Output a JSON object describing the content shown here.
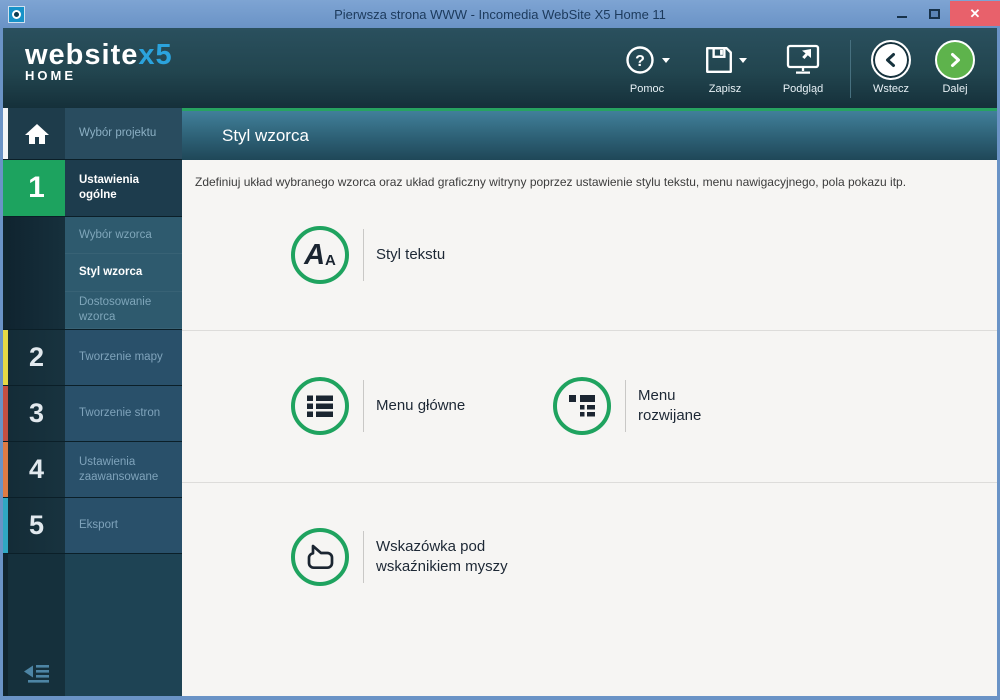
{
  "window": {
    "title": "Pierwsza strona WWW - Incomedia WebSite X5 Home 11",
    "controls": {
      "close": "✕"
    }
  },
  "toolbar": {
    "logo": {
      "brand": "website",
      "brand_accent": "x5",
      "edition": "HOME"
    },
    "help_glyph": "?",
    "buttons": [
      {
        "id": "pomoc",
        "label": "Pomoc",
        "icon": "help-icon",
        "has_dropdown": true
      },
      {
        "id": "zapisz",
        "label": "Zapisz",
        "icon": "save-icon",
        "has_dropdown": true
      },
      {
        "id": "podglad",
        "label": "Podgląd",
        "icon": "preview-icon",
        "has_dropdown": false
      }
    ],
    "nav": [
      {
        "id": "wstecz",
        "label": "Wstecz",
        "icon": "back-icon"
      },
      {
        "id": "dalej",
        "label": "Dalej",
        "icon": "next-icon"
      }
    ]
  },
  "sidebar": {
    "home_label": "Wybór projektu",
    "steps": [
      {
        "num": "1",
        "label": "Ustawienia ogólne",
        "active": true,
        "strip_color": "#1da35f"
      },
      {
        "num": "2",
        "label": "Tworzenie mapy",
        "active": false,
        "strip_color": "#e5d945"
      },
      {
        "num": "3",
        "label": "Tworzenie stron",
        "active": false,
        "strip_color": "#c44f42"
      },
      {
        "num": "4",
        "label": "Ustawienia zaawansowane",
        "active": false,
        "strip_color": "#de7b45"
      },
      {
        "num": "5",
        "label": "Eksport",
        "active": false,
        "strip_color": "#2fa7c3"
      }
    ],
    "sub_items": [
      {
        "label": "Wybór wzorca",
        "selected": false
      },
      {
        "label": "Styl wzorca",
        "selected": true
      },
      {
        "label": "Dostosowanie wzorca",
        "selected": false
      }
    ]
  },
  "main": {
    "title": "Styl wzorca",
    "description": "Zdefiniuj układ wybranego wzorca oraz układ graficzny witryny poprzez ustawienie stylu tekstu, menu nawigacyjnego, pola pokazu itp.",
    "options": [
      {
        "id": "styl-tekstu",
        "label": "Styl tekstu",
        "icon": "text-style-icon",
        "glyph_large": "A",
        "glyph_small": "A"
      },
      {
        "id": "menu-glowne",
        "label": "Menu główne",
        "icon": "main-menu-icon"
      },
      {
        "id": "menu-rozwijane",
        "label": "Menu rozwijane",
        "icon": "dropdown-menu-icon"
      },
      {
        "id": "wskazowka",
        "label": "Wskazówka pod wskaźnikiem myszy",
        "icon": "tooltip-icon"
      }
    ]
  },
  "colors": {
    "accent_green": "#1fa35f",
    "titlebar_blue": "#6a93c6",
    "toolbar_teal": "#22454f",
    "banner_teal": "#2d6075",
    "logo_accent_blue": "#2ba3dd",
    "close_red": "#e8616b"
  }
}
